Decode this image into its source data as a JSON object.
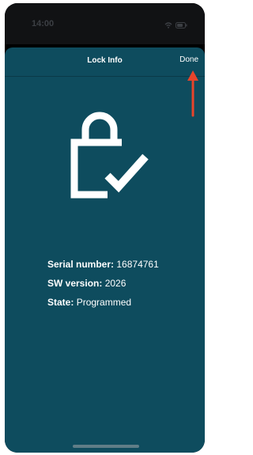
{
  "status_bar": {
    "time": "14:00",
    "icons": [
      "wifi-icon",
      "battery-icon"
    ]
  },
  "nav": {
    "title": "Lock Info",
    "done_label": "Done"
  },
  "lock_icon": "lock-check-icon",
  "info": {
    "serial_label": "Serial number:",
    "serial_value": "16874761",
    "sw_label": "SW version:",
    "sw_value": "2026",
    "state_label": "State:",
    "state_value": "Programmed"
  },
  "colors": {
    "sheet_background": "#0e4c5e",
    "annotation_arrow": "#e8442b"
  }
}
